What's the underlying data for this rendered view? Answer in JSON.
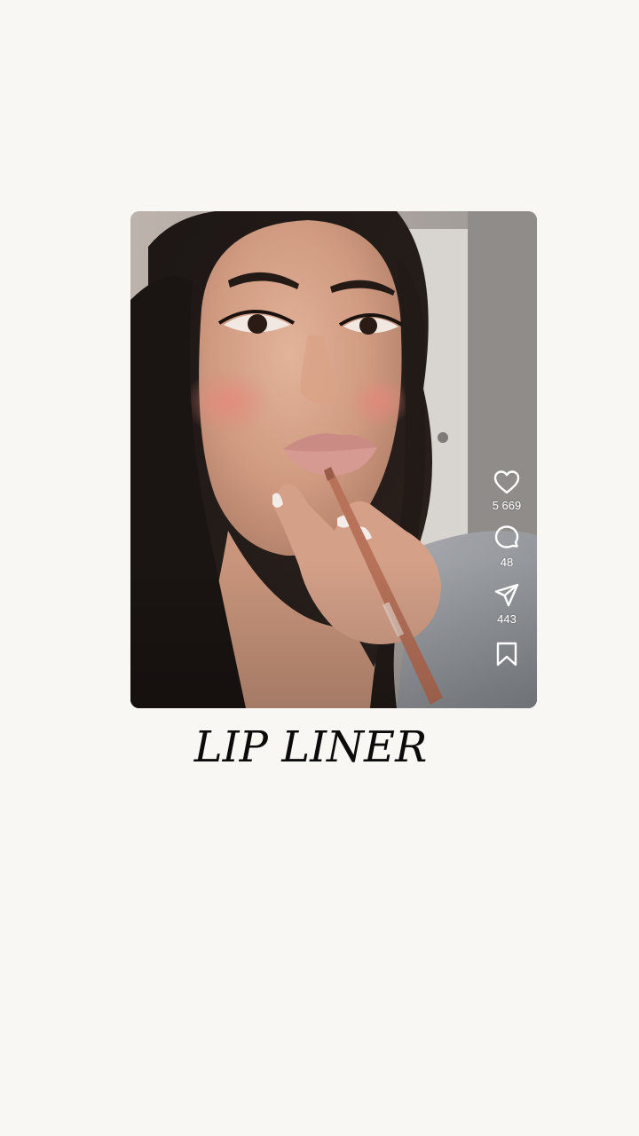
{
  "reel": {
    "actions": {
      "likes": "5 669",
      "comments": "48",
      "shares": "443"
    }
  },
  "caption": {
    "text": "LIP LINER"
  },
  "colors": {
    "background": "#f8f7f4",
    "caption": "#0b0b0b",
    "icon": "#ffffff"
  },
  "icons": [
    "heart-icon",
    "comment-icon",
    "share-icon",
    "bookmark-icon"
  ]
}
